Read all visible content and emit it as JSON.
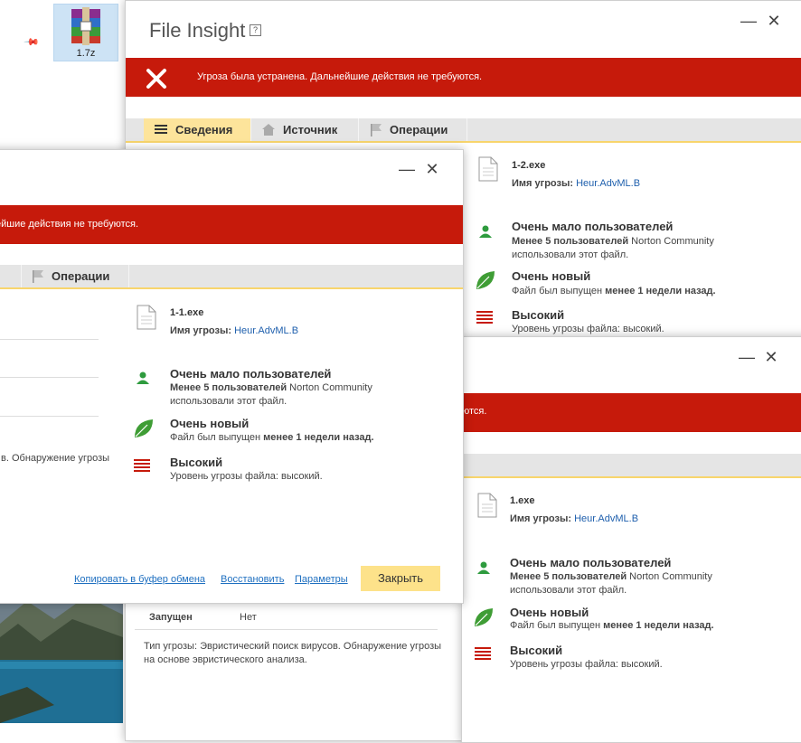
{
  "explorer": {
    "archive_label": "1.7z"
  },
  "win1": {
    "title": "File Insight",
    "help": "?",
    "banner": "Угроза была устранена. Дальнейшие действия не требуются.",
    "tabs": [
      "Сведения",
      "Источник",
      "Операции"
    ],
    "file_name": "1-2.exe",
    "threat_label": "Имя угрозы:",
    "threat_value": "Heur.AdvML.B",
    "users_title": "Очень мало пользователей",
    "users_desc_bold": "Менее 5 пользователей",
    "users_desc_rest": "Norton Community",
    "users_desc_line2": "использовали этот файл.",
    "new_title": "Очень новый",
    "new_desc_pre": "Файл был выпущен",
    "new_desc_bold": "менее 1 недели назад.",
    "risk_title": "Высокий",
    "risk_desc": "Уровень угрозы файла: высокий."
  },
  "win1_bottom": {
    "launched_label": "Запущен",
    "launched_value": "Нет",
    "threat_type_line1": "Тип угрозы: Эвристический поиск вирусов. Обнаружение угрозы",
    "threat_type_line2": "на основе эвристического анализа."
  },
  "win2": {
    "banner_fragment": "ются.",
    "file_name": "1.exe",
    "threat_label": "Имя угрозы:",
    "threat_value": "Heur.AdvML.B",
    "users_title": "Очень мало пользователей",
    "users_desc_bold": "Менее 5 пользователей",
    "users_desc_rest": "Norton Community",
    "users_desc_line2": "использовали этот файл.",
    "new_title": "Очень новый",
    "new_desc_pre": "Файл был выпущен",
    "new_desc_bold": "менее 1 недели назад.",
    "risk_title": "Высокий",
    "risk_desc": "Уровень угрозы файла: высокий."
  },
  "win3": {
    "banner_fragment": "ейшие действия не требуются.",
    "tab_ops": "Операции",
    "file_name": "1-1.exe",
    "threat_label": "Имя угрозы:",
    "threat_value": "Heur.AdvML.B",
    "users_title": "Очень мало пользователей",
    "users_desc_bold": "Менее 5 пользователей",
    "users_desc_rest": "Norton Community",
    "users_desc_line2": "использовали этот файл.",
    "new_title": "Очень новый",
    "new_desc_pre": "Файл был выпущен",
    "new_desc_bold": "менее 1 недели назад.",
    "risk_title": "Высокий",
    "risk_desc": "Уровень угрозы файла: высокий.",
    "left_fragment": "в. Обнаружение угрозы",
    "footer": {
      "copy": "Копировать в буфер обмена",
      "restore": "Восстановить",
      "params": "Параметры",
      "close": "Закрыть"
    }
  },
  "colors": {
    "banner_red": "#c61a0b",
    "tab_active": "#fde49b",
    "close_button": "#fde28a",
    "link_blue": "#1e5fad",
    "user_green": "#2e9b3e"
  },
  "icons": [
    "winrar-icon",
    "pin-icon",
    "help-icon",
    "minimize-icon",
    "close-icon",
    "error-x-icon",
    "list-icon",
    "home-icon",
    "flag-icon",
    "file-icon",
    "user-icon",
    "leaf-icon",
    "risk-bars-icon"
  ]
}
